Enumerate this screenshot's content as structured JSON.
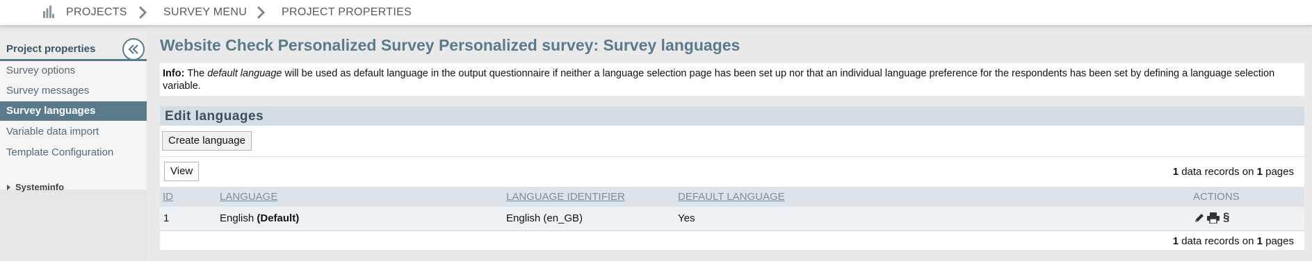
{
  "breadcrumb": {
    "items": [
      "PROJECTS",
      "SURVEY MENU",
      "PROJECT PROPERTIES"
    ]
  },
  "sidebar": {
    "title": "Project properties",
    "items": [
      {
        "label": "Survey options"
      },
      {
        "label": "Survey messages"
      },
      {
        "label": "Survey languages"
      },
      {
        "label": "Variable data import"
      },
      {
        "label": "Template Configuration"
      }
    ],
    "sysinfo": "Systeminfo"
  },
  "main": {
    "title": "Website Check Personalized Survey Personalized survey: Survey languages",
    "info": {
      "label": "Info:",
      "pre": "The",
      "em": "default language",
      "post": "will be used as default language in the output questionnaire if neither a language selection page has been set up nor that an individual language preference for the respondents has been set by defining a language selection variable."
    },
    "panel": {
      "title": "Edit languages",
      "create_button": "Create language",
      "view_button": "View"
    },
    "records": {
      "count": "1",
      "pages": "1",
      "text1": "data records on",
      "text2": "pages"
    },
    "table": {
      "columns": [
        "ID",
        "LANGUAGE",
        "LANGUAGE IDENTIFIER",
        "DEFAULT LANGUAGE",
        "ACTIONS"
      ],
      "rows": [
        {
          "id": "1",
          "language": "English",
          "default_tag": "(Default)",
          "identifier": "English (en_GB)",
          "is_default": "Yes"
        }
      ],
      "actions": [
        "edit-icon",
        "print-icon",
        "section-icon"
      ],
      "section_glyph": "§"
    }
  },
  "colors": {
    "accent": "#5b7a8c",
    "header_bg": "#d4dde3"
  }
}
